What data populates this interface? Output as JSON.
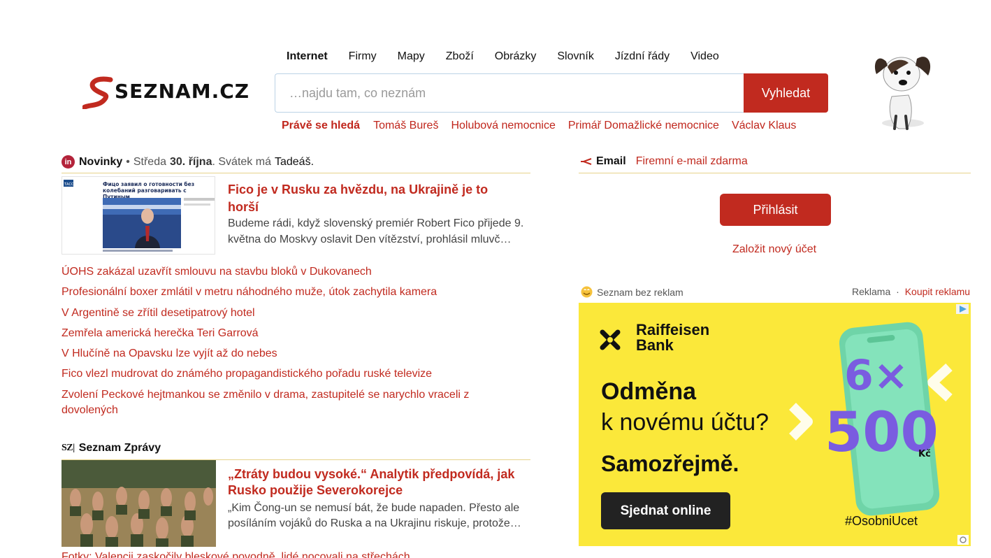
{
  "header": {
    "logo_text": "SEZNAM.CZ",
    "tabs": [
      {
        "label": "Internet",
        "active": true
      },
      {
        "label": "Firmy",
        "active": false
      },
      {
        "label": "Mapy",
        "active": false
      },
      {
        "label": "Zboží",
        "active": false
      },
      {
        "label": "Obrázky",
        "active": false
      },
      {
        "label": "Slovník",
        "active": false
      },
      {
        "label": "Jízdní řády",
        "active": false
      },
      {
        "label": "Video",
        "active": false
      }
    ],
    "search": {
      "placeholder": "…najdu tam, co neznám",
      "value": "",
      "button_label": "Vyhledat"
    },
    "trending": {
      "lead": "Právě se hledá",
      "items": [
        "Tomáš Bureš",
        "Holubová nemocnice",
        "Primář Domažlické nemocnice",
        "Václav Klaus"
      ]
    },
    "mascot_icon": "dog-mascot"
  },
  "novinky": {
    "brand": "Novinky",
    "badge": "in",
    "date_prefix": "Středa",
    "date_bold": "30. října",
    "date_suffix": ". Svátek má",
    "nameday": "Tadeáš",
    "lead_article": {
      "title": "Fico je v Rusku za hvězdu, na Ukrajině je to horší",
      "perex": "Budeme rádi, když slovenský premiér Robert Fico přijede 9. května do Moskvy oslavit Den vítězství, prohlásil mluvč…",
      "thumb_caption": "Фицо заявил о готовности без колебаний разговаривать с Путиным",
      "thumb_source": "ТАСС"
    },
    "headlines": [
      "ÚOHS zakázal uzavřít smlouvu na stavbu bloků v Dukovanech",
      "Profesionální boxer zmlátil v metru náhodného muže, útok zachytila kamera",
      "V Argentině se zřítil desetipatrový hotel",
      "Zemřela americká herečka Teri Garrová",
      "V Hlučíně na Opavsku lze vyjít až do nebes",
      "Fico vlezl mudrovat do známého propagandistického pořadu ruské televize",
      "Zvolení Peckové hejtmankou se změnilo v drama, zastupitelé se narychlo vraceli z dovolených"
    ]
  },
  "seznam_zpravy": {
    "mark": "SZ|",
    "brand": "Seznam Zprávy",
    "lead_article": {
      "title": "„Ztráty budou vysoké.“ Analytik předpovídá, jak Rusko použije Severokorejce",
      "perex": "„Kim Čong-un se nemusí bát, že bude napaden. Přesto ale posíláním vojáků do Ruska a na Ukrajinu riskuje, protože…"
    },
    "next_headline": "Fotky: Valencii zaskočily bleskové povodně, lidé nocovali na střechách"
  },
  "email": {
    "label": "Email",
    "subtitle": "Firemní e-mail zdarma",
    "login_label": "Přihlásit",
    "new_account_label": "Založit nový účet"
  },
  "ad": {
    "no_ads_label": "Seznam bez reklam",
    "ad_label": "Reklama",
    "separator": "·",
    "buy_label": "Koupit reklamu",
    "banner": {
      "bank_name_1": "Raiffeisen",
      "bank_name_2": "Bank",
      "line1": "Odměna",
      "line2": "k novému účtu?",
      "line3": "Samozřejmě.",
      "cta": "Sjednat online",
      "hashtag": "#OsobniUcet",
      "promo_1": "6×",
      "promo_2": "500",
      "promo_currency": "Kč",
      "background_color": "#fbe83a"
    }
  },
  "colors": {
    "accent": "#c12a1f",
    "rule": "#e7d38a"
  }
}
